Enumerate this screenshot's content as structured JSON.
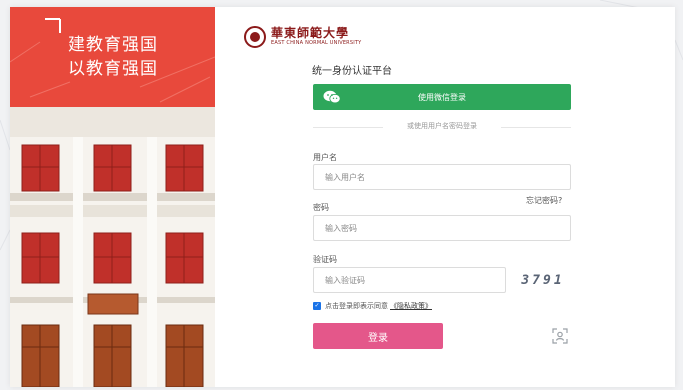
{
  "hero": {
    "slogan_line1": "建教育强国",
    "slogan_line2": "以教育强国"
  },
  "logo": {
    "name_cn": "華東師範大學",
    "name_en": "EAST CHINA NORMAL UNIVERSITY"
  },
  "title": "统一身份认证平台",
  "wechat": {
    "label": "使用微信登录",
    "icon": "wechat-icon"
  },
  "divider_text": "或使用用户名密码登录",
  "username": {
    "label": "用户名",
    "placeholder": "输入用户名"
  },
  "password": {
    "label": "密码",
    "placeholder": "输入密码",
    "forgot": "忘记密码?"
  },
  "captcha": {
    "label": "验证码",
    "placeholder": "输入验证码",
    "code": "3791"
  },
  "agreement": {
    "checked": true,
    "text": "点击登录即表示同意",
    "policy": "《隐私政策》"
  },
  "login_button": "登录",
  "scan_icon": "qr-face-scan-icon",
  "colors": {
    "wechat": "#2ea75b",
    "login": "#e4578a",
    "hero_red": "#e8493c",
    "brand": "#8b1a1a"
  }
}
